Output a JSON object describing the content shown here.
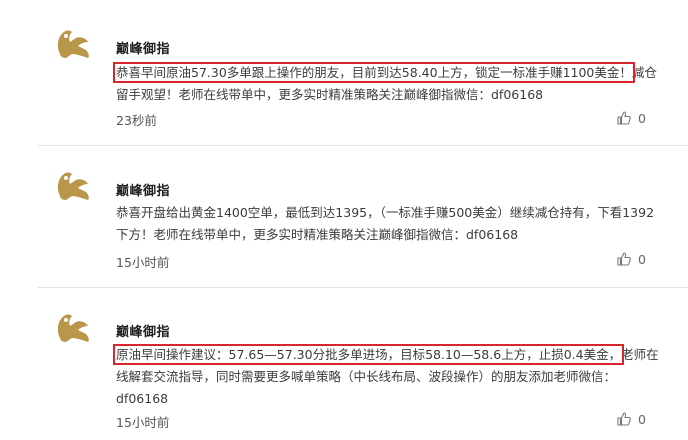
{
  "posts": [
    {
      "author": "巅峰御指",
      "text_highlight": "恭喜早间原油57.30多单跟上操作的朋友，目前到达58.40上方，锁定一标准手赚1100美金！",
      "text_rest": "减仓留手观望！老师在线带单中，更多实时精准策略关注巅峰御指微信：df06168",
      "time": "23秒前",
      "likes": "0"
    },
    {
      "author": "巅峰御指",
      "text_highlight": "",
      "text_rest": "恭喜开盘给出黄金1400空单，最低到达1395，（一标准手赚500美金）继续减仓持有，下看1392下方！老师在线带单中，更多实时精准策略关注巅峰御指微信：df06168",
      "time": "15小时前",
      "likes": "0"
    },
    {
      "author": "巅峰御指",
      "text_highlight": "原油早间操作建议：57.65—57.30分批多单进场，目标58.10—58.6上方，止损0.4美金，",
      "text_rest": "老师在线解套交流指导，同时需要更多喊单策略（中长线布局、波段操作）的朋友添加老师微信：df06168",
      "time": "15小时前",
      "likes": "0"
    }
  ],
  "icons": {
    "avatar": "golden-dragon-hand-logo",
    "like": "thumbs-up-icon"
  },
  "colors": {
    "highlight_box": "#d9262c",
    "avatar_gold": "#b8974a"
  }
}
